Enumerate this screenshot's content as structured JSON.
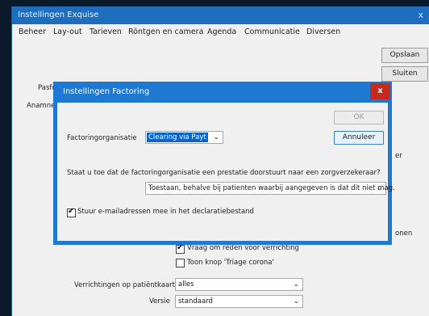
{
  "background_window": {
    "title": "Instellingen Exquise",
    "close_glyph": "x",
    "menu": [
      "Beheer",
      "Lay-out",
      "Tarieven",
      "Röntgen en camera",
      "Agenda",
      "Communicatie",
      "Diversen"
    ],
    "buttons": {
      "save": "Opslaan",
      "close": "Sluiten"
    },
    "partial_labels": {
      "left1": "Pasfo",
      "left2": "Anamne",
      "right1": "er",
      "right2": "onen"
    },
    "checkboxes": [
      {
        "label": "Vraag om reden voor verrichting",
        "checked": true
      },
      {
        "label": "Toon knop 'Triage corona'",
        "checked": false
      }
    ],
    "fields": [
      {
        "label": "Verrichtingen op patiëntkaart:",
        "value": "alles"
      },
      {
        "label": "Versie",
        "value": "standaard"
      }
    ]
  },
  "dialog": {
    "title": "Instellingen Factoring",
    "close_glyph": "x",
    "ok_label": "OK",
    "cancel_label": "Annuleer",
    "factoring_label": "Factoringorganisatie",
    "factoring_value": "Clearing via Payt",
    "question": "Staat u toe dat de factoringorganisatie een prestatie doorstuurt naar een zorgverzekeraar?",
    "question_value": "Toestaan, behalve bij patienten waarbij aangegeven is dat dit niet mag.",
    "email_checkbox": {
      "label": "Stuur e-mailadressen mee in het declaratiebestand",
      "checked": true
    }
  },
  "icons": {
    "dropdown": "chevron-down-icon",
    "check": "checkmark-icon"
  },
  "colors": {
    "title_blue": "#1e6ec0",
    "dialog_border": "#1f78d1",
    "close_red": "#c42b1c",
    "selection": "#0a64d0"
  }
}
